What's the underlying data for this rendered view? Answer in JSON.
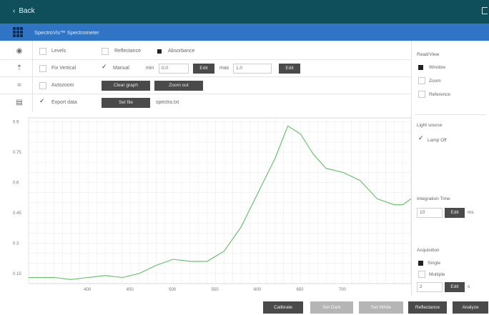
{
  "titlebar": {
    "back_label": "Back"
  },
  "appbar": {
    "title": "SpectroVis™ Spectrometer"
  },
  "toolbar": {
    "row1": {
      "levels": "Levels",
      "reflectance": "Reflectance",
      "absorbance": "Absorbance"
    },
    "row2": {
      "y_axis_label": "Fix Vertical",
      "manual_label": "Manual",
      "min_label": "min",
      "min_value": "0.0",
      "edit1": "Edit",
      "max_label": "max",
      "max_value": "1.0",
      "edit2": "Edit"
    },
    "row3": {
      "autozoom": "Autozoom",
      "clear_graph": "Clear graph",
      "zoom_out": "Zoom out"
    },
    "row4": {
      "export_data": "Export data",
      "set_file": "Set file",
      "file_name": "spectra.txt"
    }
  },
  "side": {
    "readview_title": "Read/View",
    "opt_window": "Window",
    "opt_zoom": "Zoom",
    "opt_reference": "Reference",
    "lightsource_title": "Light source",
    "lamp_label": "Lamp Off",
    "integration_title": "Integration Time",
    "integration_value": "10",
    "integration_edit": "Edit",
    "integration_unit": "ms",
    "acquisition_title": "Acquisition",
    "acq_single": "Single",
    "acq_multiple": "Multiple",
    "acq_value": "2",
    "acq_edit": "Edit",
    "acq_unit": "s"
  },
  "footer": {
    "calibrate": "Calibrate",
    "set_dark": "Set Dark",
    "set_white": "Set White",
    "reflectance": "Reflectance",
    "analyze": "Analyze"
  },
  "chart_data": {
    "type": "line",
    "series_color": "#5fbf5f",
    "ytick_labels": [
      "0.9",
      "0.75",
      "0.6",
      "0.45",
      "0.3",
      "0.15"
    ],
    "xtick_labels": [
      "400",
      "450",
      "500",
      "550",
      "600",
      "650",
      "700"
    ],
    "xlim": [
      330,
      780
    ],
    "ylim": [
      0.1,
      0.92
    ],
    "x": [
      330,
      360,
      380,
      400,
      420,
      440,
      460,
      480,
      500,
      520,
      540,
      560,
      580,
      600,
      620,
      635,
      650,
      665,
      680,
      700,
      720,
      740,
      760,
      770,
      780
    ],
    "y": [
      0.13,
      0.13,
      0.12,
      0.13,
      0.14,
      0.13,
      0.15,
      0.19,
      0.22,
      0.21,
      0.21,
      0.26,
      0.38,
      0.55,
      0.72,
      0.88,
      0.84,
      0.74,
      0.67,
      0.65,
      0.61,
      0.52,
      0.49,
      0.49,
      0.52
    ],
    "grid": true
  }
}
